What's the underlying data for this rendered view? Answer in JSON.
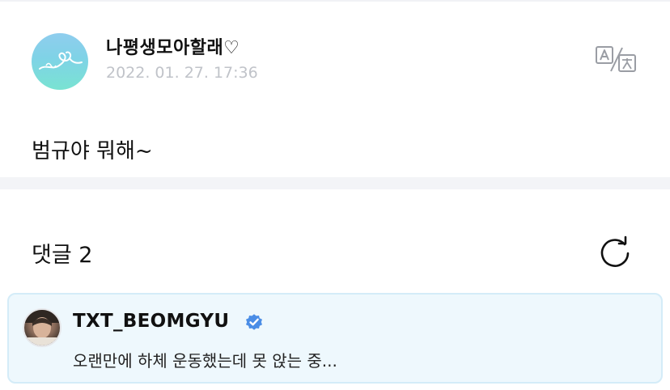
{
  "post": {
    "author": "나평생모아할래♡",
    "date": "2022. 01. 27. 17:36",
    "body": "범규야 뭐해~"
  },
  "icons": {
    "translate": "translate-icon",
    "refresh": "refresh-icon",
    "verified": "verified-badge-icon"
  },
  "comments": {
    "title": "댓글 2"
  },
  "comment": {
    "author": "TXT_BEOMGYU",
    "text": "오랜만에 하체 운동했는데 못 앉는 중..."
  },
  "colors": {
    "verified": "#4a8de6",
    "card_bg": "#eef8fd",
    "card_border": "#d4ecf8",
    "date_text": "#c0c3c9",
    "avatar_gradient_top": "#8fcdee",
    "avatar_gradient_bottom": "#79e3d2"
  }
}
